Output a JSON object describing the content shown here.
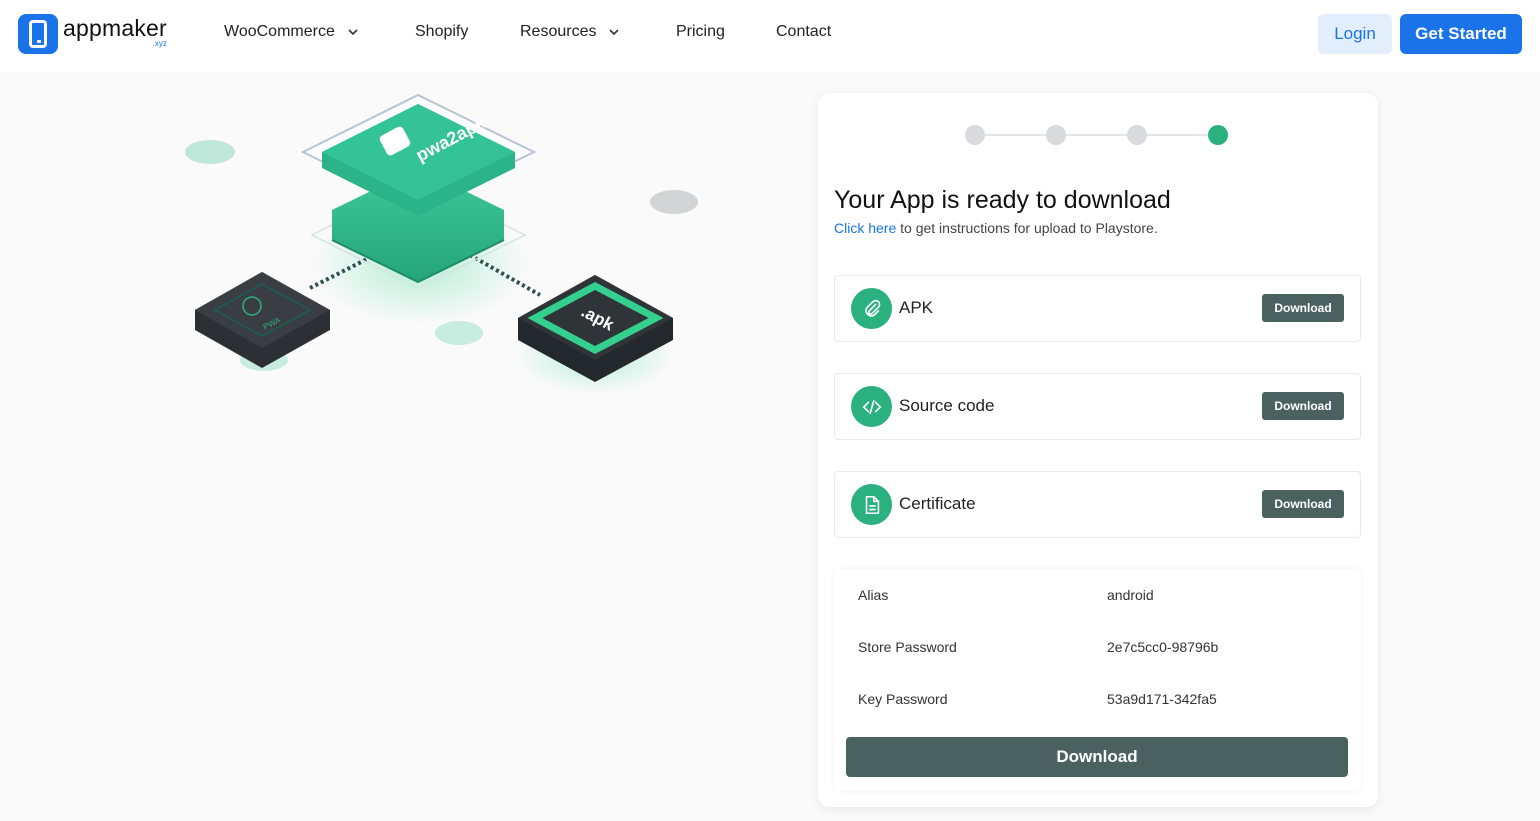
{
  "brand": {
    "name": "appmaker",
    "suffix": ".xyz",
    "color": "#1a73e8"
  },
  "nav": {
    "items": [
      {
        "label": "WooCommerce",
        "dropdown": true
      },
      {
        "label": "Shopify",
        "dropdown": false
      },
      {
        "label": "Resources",
        "dropdown": true
      },
      {
        "label": "Pricing",
        "dropdown": false
      },
      {
        "label": "Contact",
        "dropdown": false
      }
    ],
    "login": "Login",
    "get_started": "Get Started"
  },
  "illustration": {
    "top_tile_text": "pwa2apk",
    "left_tile_text": "PWA",
    "right_tile_text": ".apk"
  },
  "progress": {
    "total_steps": 4,
    "current_step": 4,
    "active_color": "#2bb07f"
  },
  "card": {
    "title": "Your App is ready to download",
    "subtitle_link": "Click here",
    "subtitle_rest": " to get instructions for upload to Playstore."
  },
  "files": [
    {
      "label": "APK",
      "icon": "paperclip-icon",
      "button": "Download"
    },
    {
      "label": "Source code",
      "icon": "code-icon",
      "button": "Download"
    },
    {
      "label": "Certificate",
      "icon": "document-icon",
      "button": "Download"
    }
  ],
  "certificate": {
    "rows": [
      {
        "key": "Alias",
        "value": "android"
      },
      {
        "key": "Store Password",
        "value": "2e7c5cc0-98796b"
      },
      {
        "key": "Key Password",
        "value": "53a9d171-342fa5"
      }
    ],
    "download_button": "Download"
  }
}
